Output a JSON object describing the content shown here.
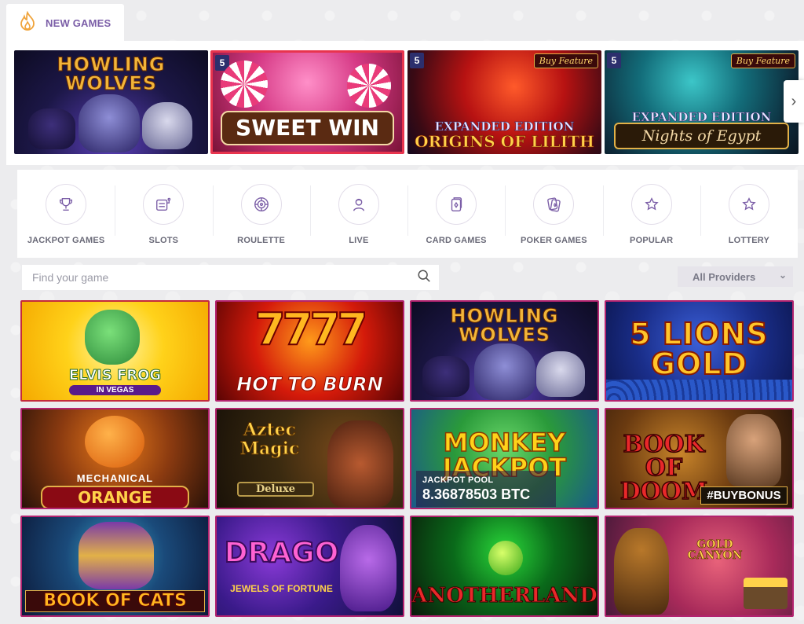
{
  "new_games": {
    "tab_label": "NEW GAMES",
    "banners": [
      {
        "title": "HOWLING WOLVES"
      },
      {
        "title": "SWEET WIN",
        "badge": "5"
      },
      {
        "badge": "5",
        "buy": "Buy Feature",
        "edition": "EXPANDED EDITION",
        "title": "ORIGINS OF LILITH"
      },
      {
        "badge": "5",
        "buy": "Buy Feature",
        "edition": "EXPANDED EDITION",
        "title": "Nights of Egypt"
      }
    ]
  },
  "categories": [
    {
      "label": "JACKPOT GAMES",
      "icon": "trophy-icon"
    },
    {
      "label": "SLOTS",
      "icon": "slot-machine-icon"
    },
    {
      "label": "ROULETTE",
      "icon": "roulette-icon"
    },
    {
      "label": "LIVE",
      "icon": "dealer-icon"
    },
    {
      "label": "CARD GAMES",
      "icon": "cards-icon"
    },
    {
      "label": "POKER GAMES",
      "icon": "poker-chip-icon"
    },
    {
      "label": "POPULAR",
      "icon": "star-icon"
    },
    {
      "label": "LOTTERY",
      "icon": "star-icon"
    }
  ],
  "search": {
    "placeholder": "Find your game"
  },
  "providers": {
    "selected": "All Providers"
  },
  "games": [
    {
      "title": "ELVIS FROG",
      "sub": "IN VEGAS"
    },
    {
      "title": "HOT TO BURN"
    },
    {
      "title": "HOWLING WOLVES"
    },
    {
      "title": "5 LIONS GOLD"
    },
    {
      "title": "ORANGE",
      "sub": "MECHANICAL"
    },
    {
      "title": "Aztec Magic",
      "sub": "Deluxe"
    },
    {
      "title": "MONKEY JACKPOT",
      "jackpot_label": "JACKPOT POOL",
      "jackpot_value": "8.36878503 BTC"
    },
    {
      "title": "BOOK OF DOOM",
      "sub": "#BUYBONUS"
    },
    {
      "title": "BOOK OF CATS"
    },
    {
      "title": "DRAGO",
      "sub": "JEWELS OF FORTUNE"
    },
    {
      "title": "ANOTHERLAND"
    },
    {
      "title": "GOLD CANYON"
    }
  ],
  "colors": {
    "accent": "#7b5ea7",
    "tile_border": "#b3236f"
  }
}
